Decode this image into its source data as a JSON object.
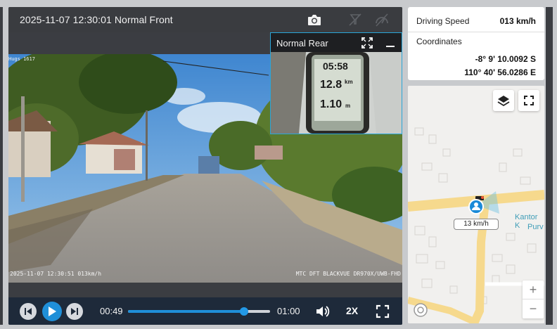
{
  "player": {
    "title": "2025-11-07 12:30:01 Normal Front",
    "icons": {
      "snapshot": "camera-icon",
      "muted_a": "no-signal-icon",
      "muted_b": "no-speed-icon"
    },
    "osd_left": "2025-11-07 12:30:51 013km/h",
    "osd_right": "MTC DFT BLACKVUE DR970X/UWB-FHD",
    "osd_top": "Hugs 1617"
  },
  "rear": {
    "title": "Normal Rear",
    "gps_lines": [
      "05:58",
      "12.8",
      "1.10"
    ],
    "gps_units": [
      "km",
      "m"
    ]
  },
  "controls": {
    "current_time": "00:49",
    "total_time": "01:00",
    "progress": 0.817,
    "speed_label": "2X"
  },
  "info": {
    "speed_label": "Driving Speed",
    "speed_value": "013 km/h",
    "coords_label": "Coordinates",
    "lat": "-8° 9' 10.0092 S",
    "lon": "110° 40' 56.0286 E"
  },
  "map": {
    "marker_speed": "13 km/h",
    "poi_line1": "Kantor K",
    "poi_line2": "Purv",
    "zoom_in": "+",
    "zoom_out": "−",
    "colors": {
      "road": "#f6d98d",
      "marker": "#1a8ad8",
      "accent": "#1f8fd8"
    }
  }
}
